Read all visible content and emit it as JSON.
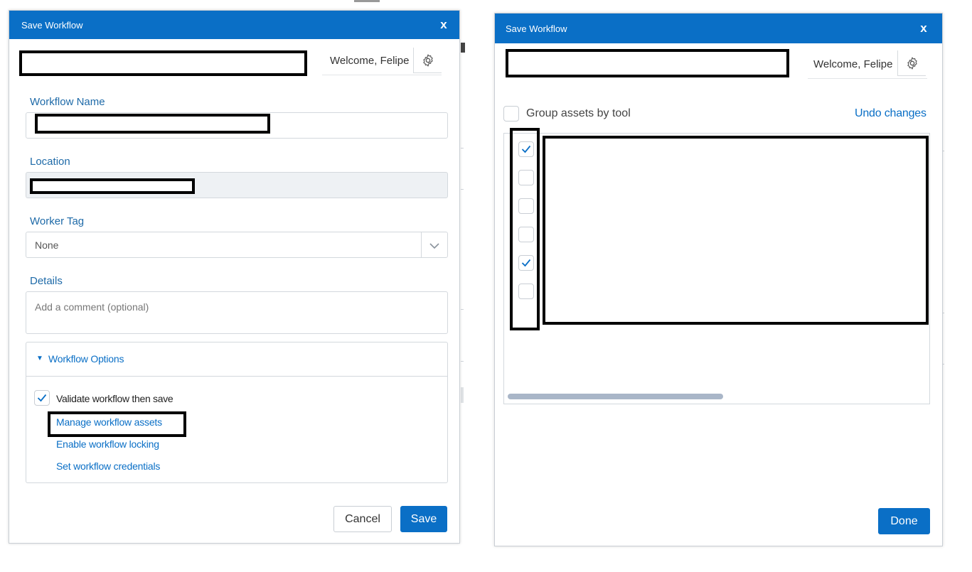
{
  "left_dialog": {
    "title": "Save Workflow",
    "close_glyph": "x",
    "welcome": "Welcome, Felipe",
    "gear_icon": "gear-icon",
    "workflow_name_label": "Workflow Name",
    "location_label": "Location",
    "worker_tag_label": "Worker Tag",
    "worker_tag_value": "None",
    "details_label": "Details",
    "details_placeholder": "Add a comment (optional)",
    "options_header": "Workflow Options",
    "options_caret": "▼",
    "validate_label": "Validate workflow then save",
    "validate_checked": true,
    "link_manage_assets": "Manage workflow assets",
    "link_enable_locking": "Enable workflow locking",
    "link_set_credentials": "Set workflow credentials",
    "cancel_label": "Cancel",
    "save_label": "Save"
  },
  "right_dialog": {
    "title": "Save Workflow",
    "close_glyph": "x",
    "welcome": "Welcome, Felipe",
    "gear_icon": "gear-icon",
    "group_assets_label": "Group assets by tool",
    "group_assets_checked": false,
    "undo_label": "Undo changes",
    "asset_rows": [
      {
        "checked": true
      },
      {
        "checked": false
      },
      {
        "checked": false
      },
      {
        "checked": false
      },
      {
        "checked": true
      },
      {
        "checked": false
      }
    ],
    "done_label": "Done"
  },
  "colors": {
    "accent": "#0a6fc6",
    "link": "#0a6fc6",
    "label": "#1e6aa8"
  }
}
